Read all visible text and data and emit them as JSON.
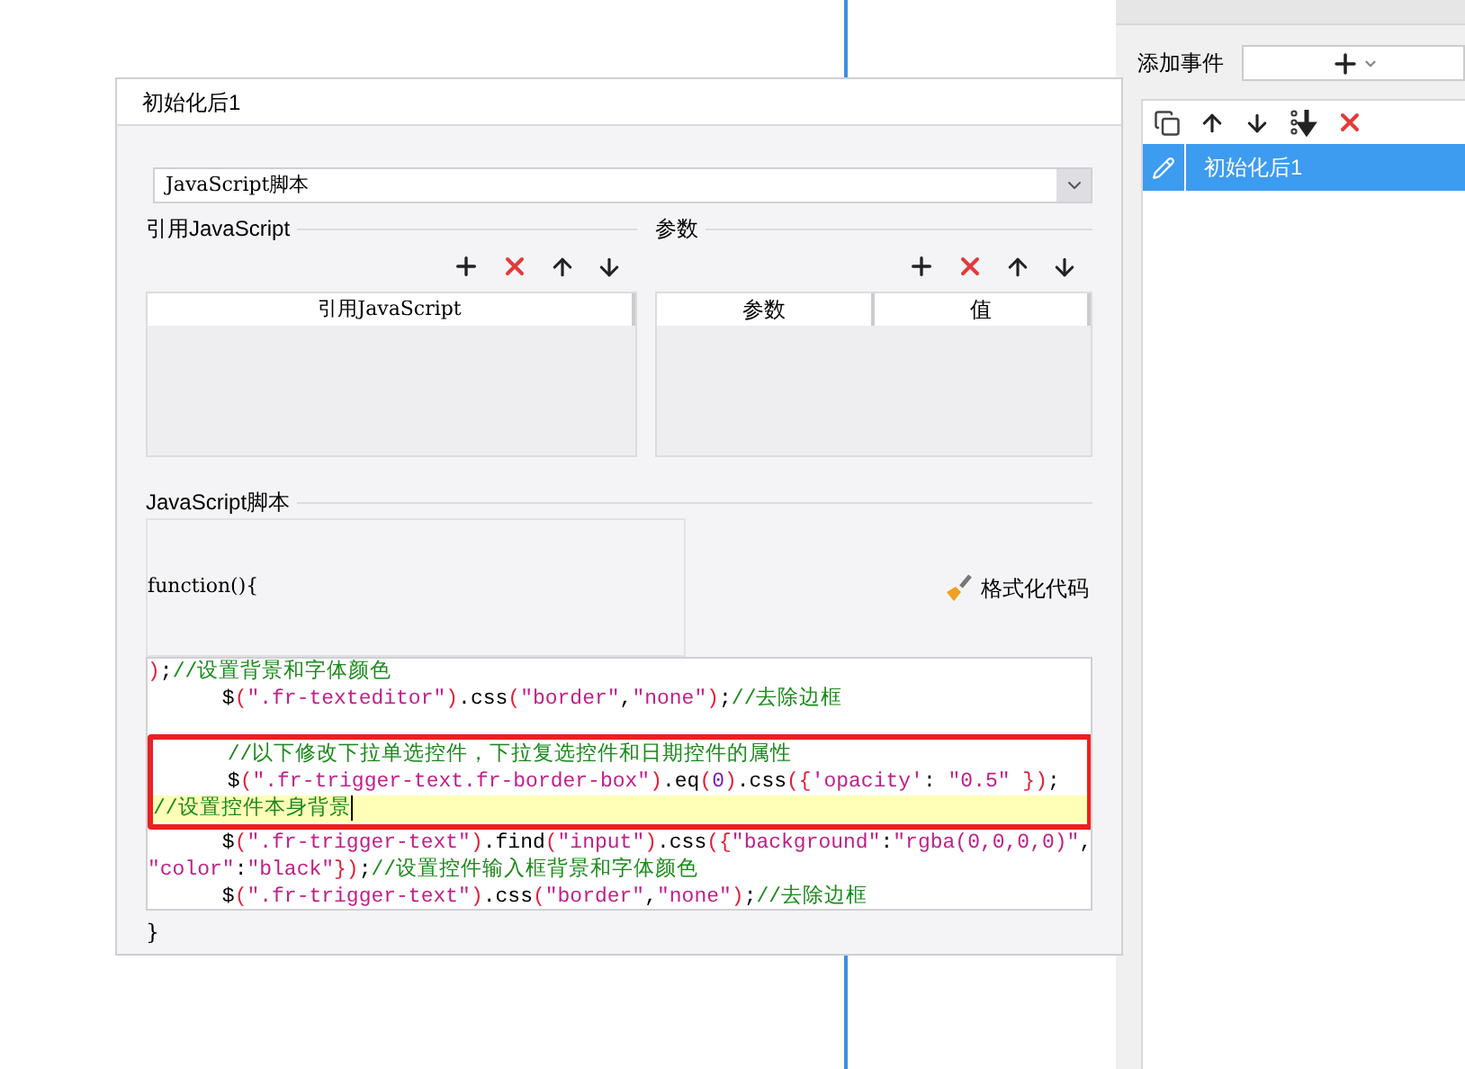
{
  "event_panel": {
    "label": "添加事件"
  },
  "events": [
    {
      "name": "初始化后1",
      "selected": true
    }
  ],
  "dialog": {
    "title": "初始化后1",
    "type_select": {
      "value": "JavaScript脚本"
    },
    "ref_section": {
      "title": "引用JavaScript",
      "columns": [
        "引用JavaScript"
      ]
    },
    "param_section": {
      "title": "参数",
      "columns": [
        "参数",
        "值"
      ]
    },
    "script_section": {
      "title": "JavaScript脚本",
      "header": "function(){",
      "format_button": "格式化代码",
      "footer": "}",
      "lines": [
        {
          "selected": false,
          "boxed": false,
          "tokens": [
            {
              "text": ")",
              "kind": "paren"
            },
            {
              "text": ";",
              "kind": "plain"
            },
            {
              "text": "//设置背景和字体颜色",
              "kind": "comment"
            }
          ]
        },
        {
          "selected": false,
          "boxed": false,
          "tokens": [
            {
              "text": "      $",
              "kind": "plain"
            },
            {
              "text": "(",
              "kind": "paren"
            },
            {
              "text": "\".fr-texteditor\"",
              "kind": "string"
            },
            {
              "text": ")",
              "kind": "paren"
            },
            {
              "text": ".css",
              "kind": "plain"
            },
            {
              "text": "(",
              "kind": "paren"
            },
            {
              "text": "\"border\"",
              "kind": "string"
            },
            {
              "text": ",",
              "kind": "plain"
            },
            {
              "text": "\"none\"",
              "kind": "string"
            },
            {
              "text": ")",
              "kind": "paren"
            },
            {
              "text": ";",
              "kind": "plain"
            },
            {
              "text": "//去除边框",
              "kind": "comment"
            }
          ]
        },
        {
          "selected": false,
          "boxed": true,
          "tokens": [
            {
              "text": "      //以下修改下拉单选控件，下拉复选控件和日期控件的属性",
              "kind": "comment"
            }
          ]
        },
        {
          "selected": false,
          "boxed": true,
          "tokens": [
            {
              "text": "      $",
              "kind": "plain"
            },
            {
              "text": "(",
              "kind": "paren"
            },
            {
              "text": "\".fr-trigger-text.fr-border-box\"",
              "kind": "string"
            },
            {
              "text": ")",
              "kind": "paren"
            },
            {
              "text": ".eq",
              "kind": "plain"
            },
            {
              "text": "(",
              "kind": "paren"
            },
            {
              "text": "0",
              "kind": "number"
            },
            {
              "text": ")",
              "kind": "paren"
            },
            {
              "text": ".css",
              "kind": "plain"
            },
            {
              "text": "({",
              "kind": "paren"
            },
            {
              "text": "'opacity'",
              "kind": "string"
            },
            {
              "text": ": ",
              "kind": "plain"
            },
            {
              "text": "\"0.5\"",
              "kind": "string"
            },
            {
              "text": " })",
              "kind": "paren"
            },
            {
              "text": ";",
              "kind": "plain"
            }
          ]
        },
        {
          "selected": true,
          "boxed": true,
          "tokens": [
            {
              "text": "//设置控件本身背景",
              "kind": "comment"
            }
          ]
        },
        {
          "selected": false,
          "boxed": false,
          "tokens": [
            {
              "text": "      $",
              "kind": "plain"
            },
            {
              "text": "(",
              "kind": "paren"
            },
            {
              "text": "\".fr-trigger-text\"",
              "kind": "string"
            },
            {
              "text": ")",
              "kind": "paren"
            },
            {
              "text": ".find",
              "kind": "plain"
            },
            {
              "text": "(",
              "kind": "paren"
            },
            {
              "text": "\"input\"",
              "kind": "string"
            },
            {
              "text": ")",
              "kind": "paren"
            },
            {
              "text": ".css",
              "kind": "plain"
            },
            {
              "text": "({",
              "kind": "paren"
            },
            {
              "text": "\"background\"",
              "kind": "string"
            },
            {
              "text": ":",
              "kind": "plain"
            },
            {
              "text": "\"rgba(0,0,0,0)\"",
              "kind": "string"
            },
            {
              "text": ",",
              "kind": "plain"
            }
          ]
        },
        {
          "selected": false,
          "boxed": false,
          "tokens": [
            {
              "text": "\"color\"",
              "kind": "string"
            },
            {
              "text": ":",
              "kind": "plain"
            },
            {
              "text": "\"black\"",
              "kind": "string"
            },
            {
              "text": "})",
              "kind": "paren"
            },
            {
              "text": ";",
              "kind": "plain"
            },
            {
              "text": "//设置控件输入框背景和字体颜色",
              "kind": "comment"
            }
          ]
        },
        {
          "selected": false,
          "boxed": false,
          "tokens": [
            {
              "text": "      $",
              "kind": "plain"
            },
            {
              "text": "(",
              "kind": "paren"
            },
            {
              "text": "\".fr-trigger-text\"",
              "kind": "string"
            },
            {
              "text": ")",
              "kind": "paren"
            },
            {
              "text": ".css",
              "kind": "plain"
            },
            {
              "text": "(",
              "kind": "paren"
            },
            {
              "text": "\"border\"",
              "kind": "string"
            },
            {
              "text": ",",
              "kind": "plain"
            },
            {
              "text": "\"none\"",
              "kind": "string"
            },
            {
              "text": ")",
              "kind": "paren"
            },
            {
              "text": ";",
              "kind": "plain"
            },
            {
              "text": "//去除边框",
              "kind": "comment"
            }
          ]
        }
      ]
    }
  }
}
